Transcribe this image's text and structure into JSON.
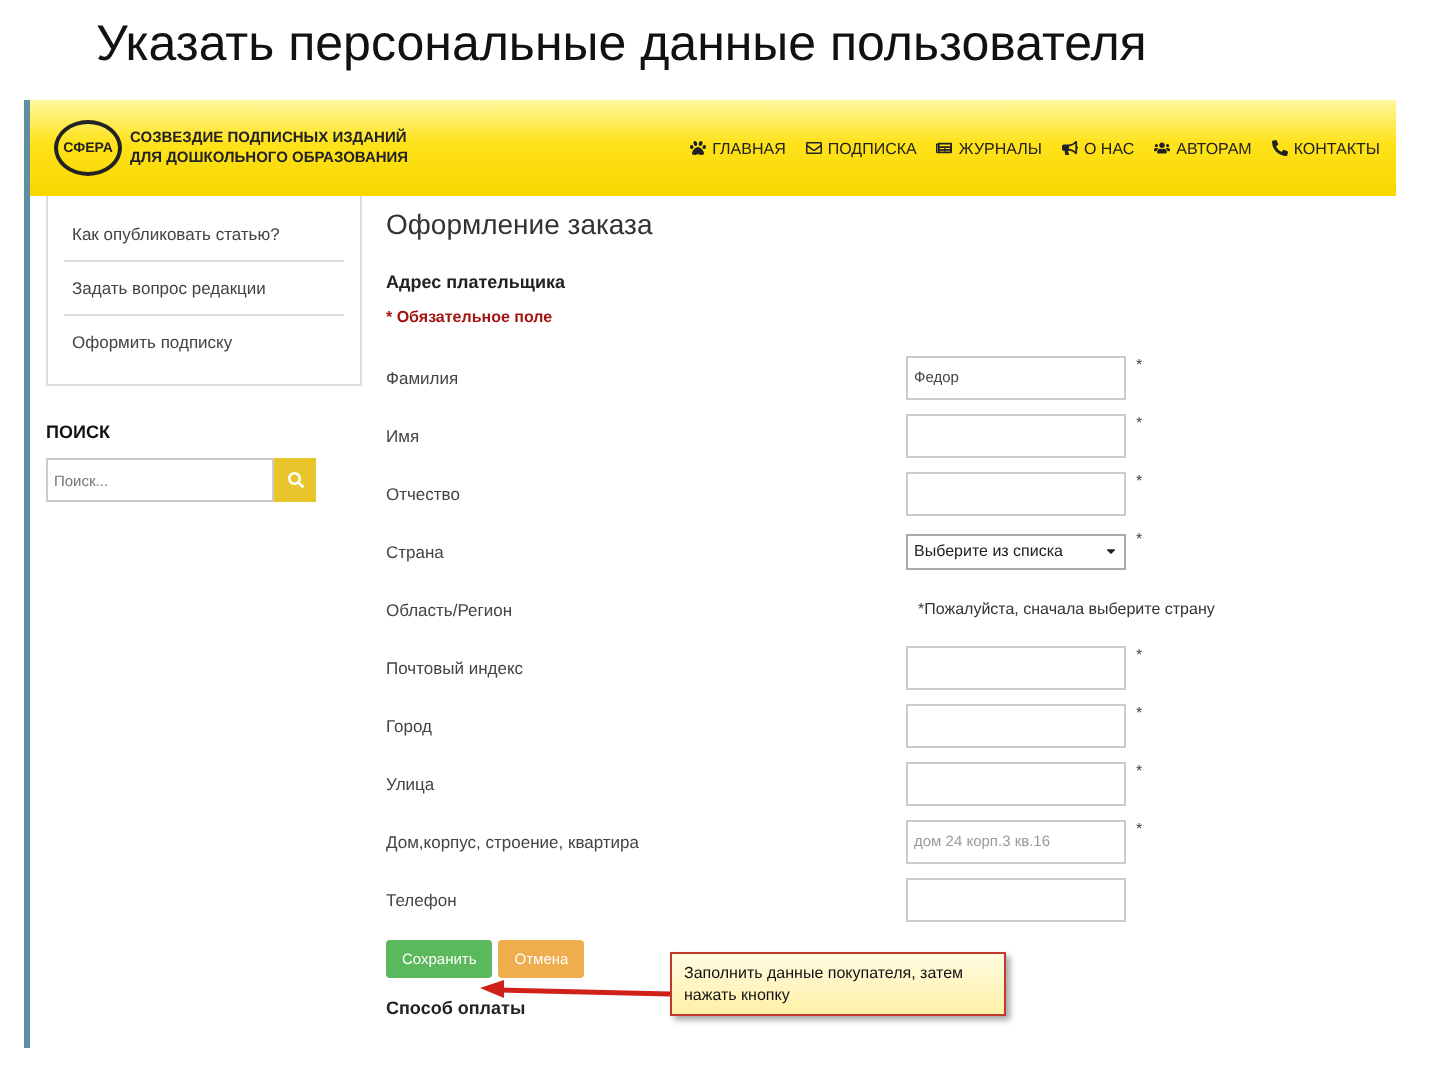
{
  "slide_title": "Указать персональные данные пользователя",
  "site": {
    "logo": {
      "mark": "СФЕРА",
      "line1": "СОЗВЕЗДИЕ ПОДПИСНЫХ ИЗДАНИЙ",
      "line2": "ДЛЯ ДОШКОЛЬНОГО ОБРАЗОВАНИЯ"
    },
    "nav": [
      {
        "label": "ГЛАВНАЯ"
      },
      {
        "label": "ПОДПИСКА"
      },
      {
        "label": "ЖУРНАЛЫ"
      },
      {
        "label": "О НАС"
      },
      {
        "label": "АВТОРАМ"
      },
      {
        "label": "КОНТАКТЫ"
      }
    ],
    "sidebar": {
      "links": [
        "Как опубликовать статью?",
        "Задать вопрос редакции",
        "Оформить подписку"
      ],
      "search_title": "ПОИСК",
      "search": {
        "placeholder": "Поиск..."
      }
    },
    "form": {
      "title": "Оформление заказа",
      "section": "Адрес плательщика",
      "required_note": "* Обязательное поле",
      "required_mark": "*",
      "fields": [
        {
          "label": "Фамилия",
          "kind": "text",
          "value": "Федор",
          "required": true
        },
        {
          "label": "Имя",
          "kind": "text",
          "required": true
        },
        {
          "label": "Отчество",
          "kind": "text",
          "required": true
        },
        {
          "label": "Страна",
          "kind": "select",
          "value": "Выберите из списка",
          "required": true
        },
        {
          "label": "Область/Регион",
          "kind": "note",
          "hint": "*Пожалуйста, сначала выберите страну",
          "required": false
        },
        {
          "label": "Почтовый индекс",
          "kind": "text",
          "required": true
        },
        {
          "label": "Город",
          "kind": "text",
          "required": true
        },
        {
          "label": "Улица",
          "kind": "text",
          "required": true
        },
        {
          "label": "Дом,корпус, строение, квартира",
          "kind": "text",
          "placeholder": "дом 24 корп.3 кв.16",
          "required": true
        },
        {
          "label": "Телефон",
          "kind": "text",
          "required": false
        }
      ],
      "buttons": [
        {
          "label": "Сохранить",
          "kind": "save"
        },
        {
          "label": "Отмена",
          "kind": "cancel"
        }
      ],
      "next_section": "Способ оплаты"
    }
  },
  "callout": {
    "text": "Заполнить данные покупателя, затем нажать кнопку"
  }
}
